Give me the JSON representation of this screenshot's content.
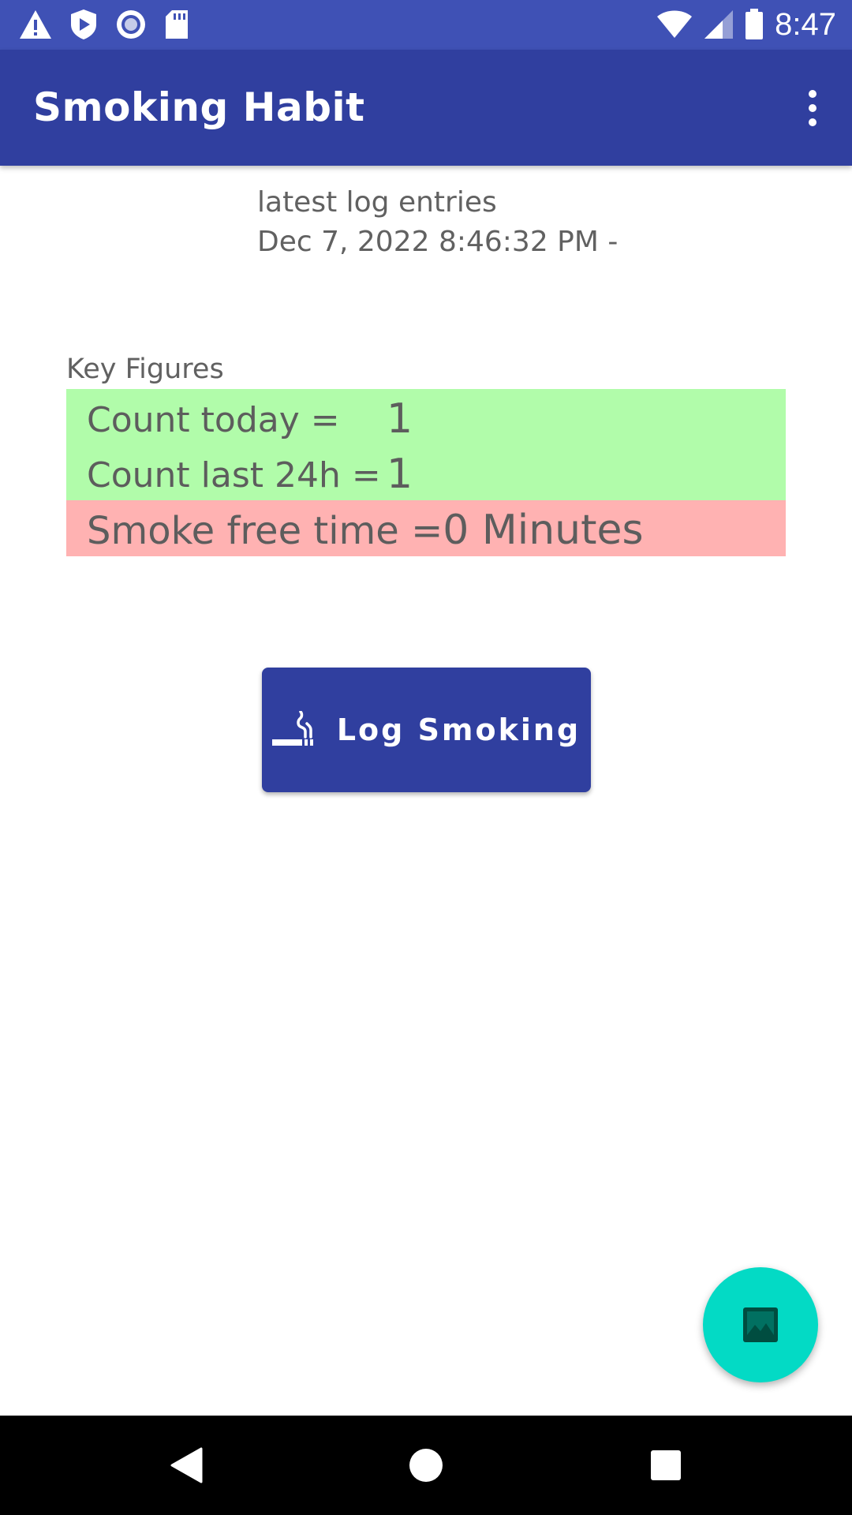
{
  "status_bar": {
    "time": "8:47",
    "left_icons": [
      "warning-icon",
      "shield-play-icon",
      "record-icon",
      "sd-card-icon"
    ],
    "right_icons": [
      "wifi-icon",
      "cell-signal-icon",
      "battery-icon"
    ]
  },
  "app_bar": {
    "title": "Smoking Habit",
    "menu_icon": "more-vert-icon"
  },
  "latest_log": {
    "label": "latest log entries",
    "entry": "Dec 7, 2022 8:46:32 PM -"
  },
  "key_figures": {
    "label": "Key Figures",
    "count_today_label": "Count today =",
    "count_today_value": "1",
    "count_24h_label": "Count last 24h =",
    "count_24h_value": "1",
    "smoke_free_label": "Smoke free time =",
    "smoke_free_value": "0 Minutes",
    "good_color": "#B1FCAA",
    "bad_color": "#FFB2B2"
  },
  "log_button": {
    "label": "Log Smoking",
    "icon": "smoking-icon"
  },
  "fab": {
    "icon": "image-icon",
    "color": "#03DAC5"
  },
  "nav_bar": {
    "back_icon": "back-icon",
    "home_icon": "home-icon",
    "recents_icon": "recents-icon"
  },
  "colors": {
    "primary": "#3F51B5",
    "primary_dark": "#303F9F",
    "accent": "#03DAC5"
  }
}
